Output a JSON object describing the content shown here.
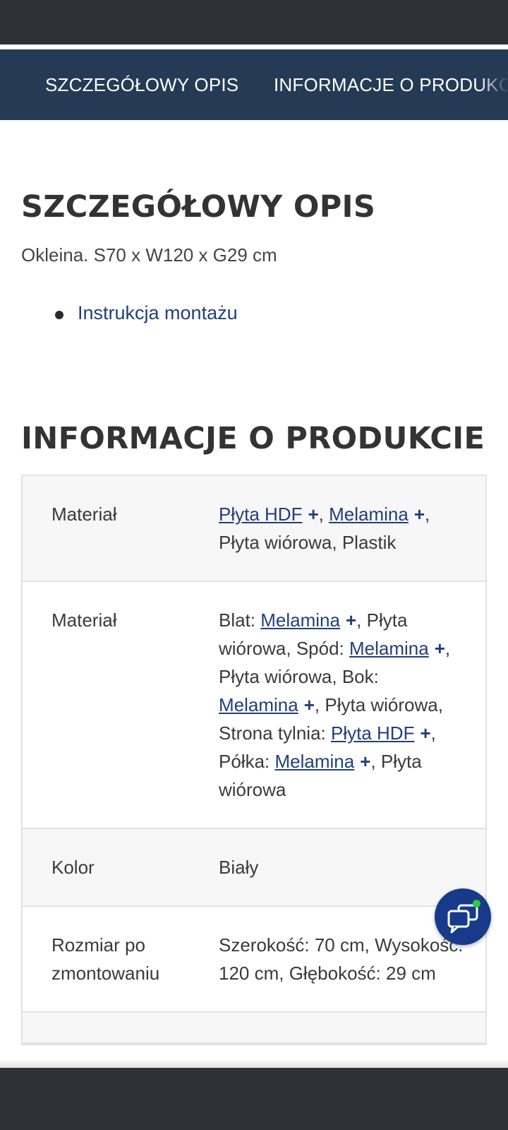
{
  "tabs": [
    "SZCZEGÓŁOWY OPIS",
    "INFORMACJE O PRODUKCIE"
  ],
  "description": {
    "heading": "SZCZEGÓŁOWY OPIS",
    "text": "Okleina. S70 x W120 x G29 cm",
    "link": "Instrukcja montażu"
  },
  "info": {
    "heading": "INFORMACJE O PRODUKCIE",
    "rows": [
      {
        "label": "Materiał",
        "parts": {
          "l1": "Płyta HDF",
          "s1": ", ",
          "l2": "Melamina",
          "s2": ", Płyta wiórowa, Plastik"
        }
      },
      {
        "label": "Materiał",
        "parts": {
          "t0": "Blat: ",
          "l1": "Melamina",
          "t1": ", Płyta wiórowa, Spód: ",
          "l2": "Melamina",
          "t2": ", Płyta wiórowa, Bok: ",
          "l3": "Melamina",
          "t3": ", Płyta wiórowa, Strona tylnia: ",
          "l4": "Płyta HDF",
          "t4": ", Półka: ",
          "l5": "Melamina",
          "t5": ", Płyta wiórowa"
        }
      },
      {
        "label": "Kolor",
        "value": "Biały"
      },
      {
        "label": "Rozmiar po zmontowaniu",
        "value": "Szerokość: 70 cm, Wysokość: 120 cm, Głębokość: 29 cm"
      }
    ],
    "plus_glyph": "+"
  },
  "colors": {
    "nav_bg": "#253b55",
    "link": "#213f7a",
    "chat_button": "#173a8a"
  },
  "icons": {
    "chat": "chat-bubbles-icon"
  }
}
